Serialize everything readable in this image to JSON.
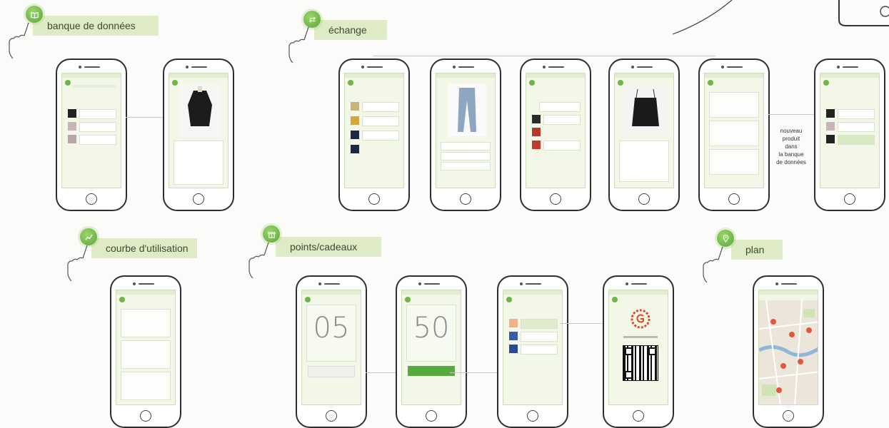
{
  "sections": {
    "banque": {
      "label": "banque de données",
      "icon": "book-icon"
    },
    "echange": {
      "label": "échange",
      "icon": "swap-arrows-icon"
    },
    "courbe": {
      "label": "courbe d'utilisation",
      "icon": "chart-line-icon"
    },
    "points": {
      "label": "points/cadeaux",
      "icon": "gift-icon"
    },
    "plan": {
      "label": "plan",
      "icon": "map-pin-icon"
    }
  },
  "echange_note": [
    "nouveau",
    "produit",
    "dans",
    "la banque",
    "de données"
  ],
  "points_screens": {
    "counter_1": "05",
    "counter_2": "50"
  },
  "colors": {
    "accent_green": "#5da637",
    "banner_bg": "#deebc5",
    "phone_screen": "#f2f7e8"
  }
}
